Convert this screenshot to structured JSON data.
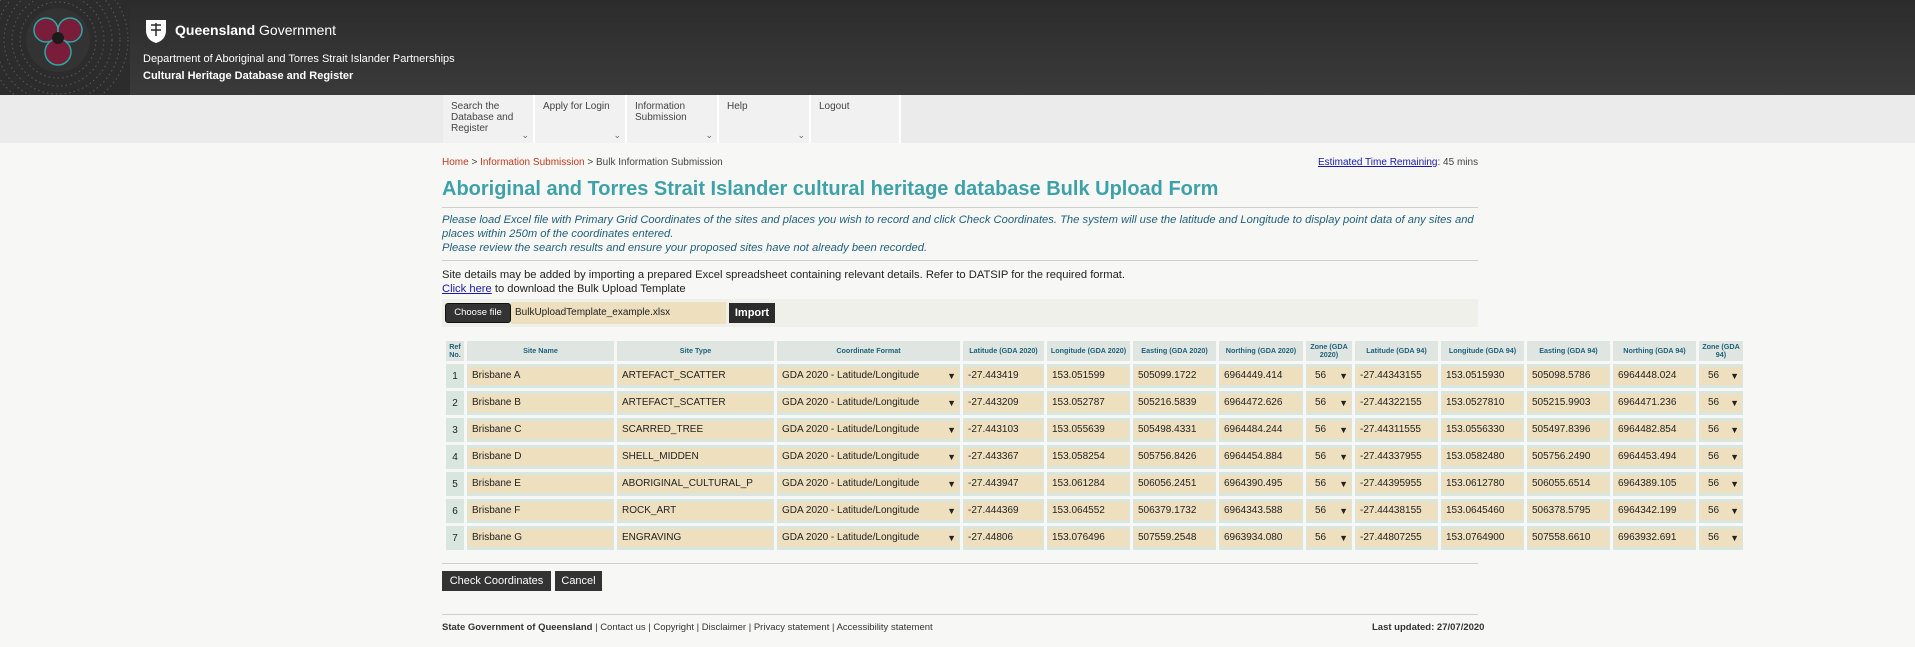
{
  "header": {
    "gov_bold": "Queensland",
    "gov_rest": " Government",
    "department": "Department of Aboriginal and Torres Strait Islander Partnerships",
    "site_title": "Cultural Heritage Database and Register"
  },
  "nav": [
    {
      "label": "Search the Database and Register",
      "chevron": true
    },
    {
      "label": "Apply for Login",
      "chevron": true
    },
    {
      "label": "Information Submission",
      "chevron": true
    },
    {
      "label": "Help",
      "chevron": true
    },
    {
      "label": "Logout",
      "chevron": false
    }
  ],
  "breadcrumb": {
    "home": "Home",
    "sep1": " > ",
    "info": "Information Submission",
    "sep2": " > ",
    "current": "Bulk Information Submission"
  },
  "eta": {
    "link": "Estimated Time Remaining",
    "value": ": 45 mins"
  },
  "title": "Aboriginal and Torres Strait Islander cultural heritage database Bulk Upload Form",
  "instructions": {
    "line1": "Please load Excel file with Primary Grid Coordinates of the sites and places you wish to record and click Check Coordinates. The system will use the latitude and Longitude to display point data of any sites and places within 250m of the coordinates entered.",
    "line2": "Please review the search results and ensure your proposed sites have not already been recorded."
  },
  "note": {
    "line1": "Site details may be added by importing a prepared Excel spreadsheet containing relevant details. Refer to DATSIP for the required format.",
    "link": "Click here",
    "line2_rest": " to download the Bulk Upload Template"
  },
  "upload": {
    "choose_label": "Choose file",
    "file_name": "BulkUploadTemplate_example.xlsx",
    "import_label": "Import"
  },
  "table": {
    "headers": [
      "Ref No.",
      "Site Name",
      "Site Type",
      "Coordinate Format",
      "Latitude (GDA 2020)",
      "Longitude (GDA 2020)",
      "Easting (GDA 2020)",
      "Northing (GDA 2020)",
      "Zone (GDA 2020)",
      "Latitude (GDA 94)",
      "Longitude (GDA 94)",
      "Easting (GDA 94)",
      "Northing (GDA 94)",
      "Zone (GDA 94)"
    ],
    "rows": [
      [
        "1",
        "Brisbane A",
        "ARTEFACT_SCATTER",
        "GDA 2020 - Latitude/Longitude",
        "-27.443419",
        "153.051599",
        "505099.1722",
        "6964449.414",
        "56",
        "-27.44343155",
        "153.0515930",
        "505098.5786",
        "6964448.024",
        "56"
      ],
      [
        "2",
        "Brisbane B",
        "ARTEFACT_SCATTER",
        "GDA 2020 - Latitude/Longitude",
        "-27.443209",
        "153.052787",
        "505216.5839",
        "6964472.626",
        "56",
        "-27.44322155",
        "153.0527810",
        "505215.9903",
        "6964471.236",
        "56"
      ],
      [
        "3",
        "Brisbane C",
        "SCARRED_TREE",
        "GDA 2020 - Latitude/Longitude",
        "-27.443103",
        "153.055639",
        "505498.4331",
        "6964484.244",
        "56",
        "-27.44311555",
        "153.0556330",
        "505497.8396",
        "6964482.854",
        "56"
      ],
      [
        "4",
        "Brisbane D",
        "SHELL_MIDDEN",
        "GDA 2020 - Latitude/Longitude",
        "-27.443367",
        "153.058254",
        "505756.8426",
        "6964454.884",
        "56",
        "-27.44337955",
        "153.0582480",
        "505756.2490",
        "6964453.494",
        "56"
      ],
      [
        "5",
        "Brisbane E",
        "ABORIGINAL_CULTURAL_P",
        "GDA 2020 - Latitude/Longitude",
        "-27.443947",
        "153.061284",
        "506056.2451",
        "6964390.495",
        "56",
        "-27.44395955",
        "153.0612780",
        "506055.6514",
        "6964389.105",
        "56"
      ],
      [
        "6",
        "Brisbane F",
        "ROCK_ART",
        "GDA 2020 - Latitude/Longitude",
        "-27.444369",
        "153.064552",
        "506379.1732",
        "6964343.588",
        "56",
        "-27.44438155",
        "153.0645460",
        "506378.5795",
        "6964342.199",
        "56"
      ],
      [
        "7",
        "Brisbane G",
        "ENGRAVING",
        "GDA 2020 - Latitude/Longitude",
        "-27.44806",
        "153.076496",
        "507559.2548",
        "6963934.080",
        "56",
        "-27.44807255",
        "153.0764900",
        "507558.6610",
        "6963932.691",
        "56"
      ]
    ]
  },
  "actions": {
    "check": "Check Coordinates",
    "cancel": "Cancel"
  },
  "footer": {
    "bold": "State Government of Queensland",
    "links": " | Contact us | Copyright | Disclaimer | Privacy statement | Accessibility statement",
    "updated": "Last updated: 27/07/2020"
  }
}
